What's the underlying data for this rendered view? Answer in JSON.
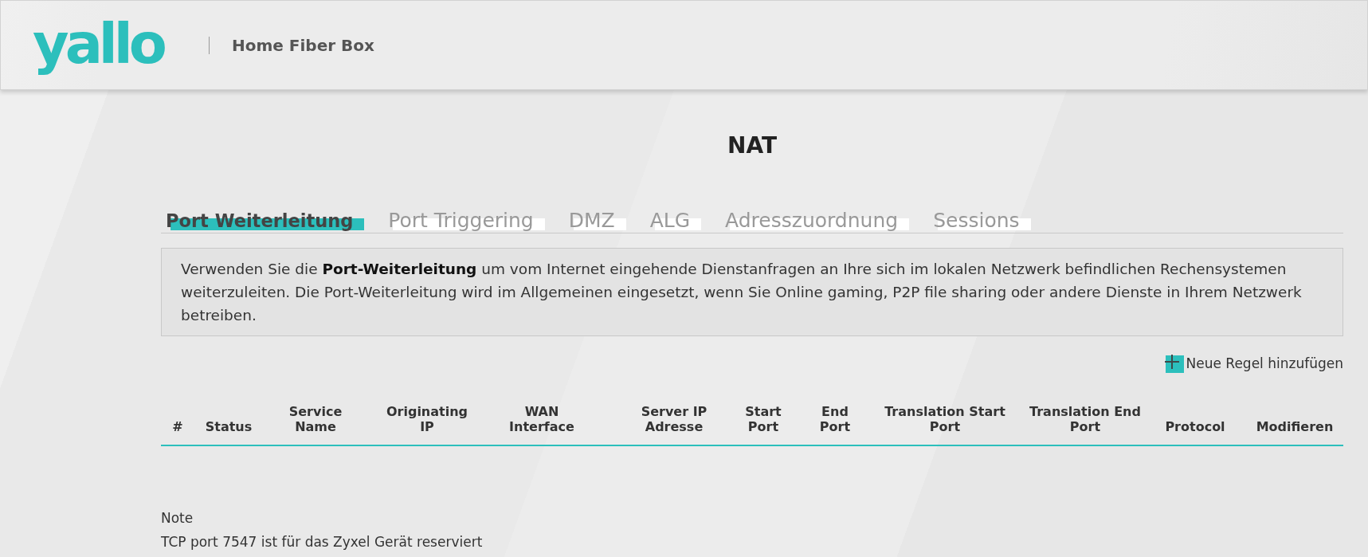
{
  "header": {
    "logo": "yallo",
    "title": "Home Fiber Box"
  },
  "page_title": "NAT",
  "tabs": [
    {
      "label": "Port Weiterleitung",
      "selected": true
    },
    {
      "label": "Port Triggering",
      "selected": false
    },
    {
      "label": "DMZ",
      "selected": false
    },
    {
      "label": "ALG",
      "selected": false
    },
    {
      "label": "Adresszuordnung",
      "selected": false
    },
    {
      "label": "Sessions",
      "selected": false
    }
  ],
  "description": "Verwenden Sie die **Port-Weiterleitung** um vom Internet eingehende Dienstanfragen an Ihre sich im lokalen Netzwerk befindlichen Rechensystemen weiterzuleiten. Die Port-Weiterleitung wird im Allgemeinen eingesetzt, wenn Sie Online gaming, P2P file sharing oder andere Dienste in Ihrem Netzwerk betreiben.",
  "add_rule": {
    "label": "Neue Regel hinzufügen"
  },
  "table": {
    "columns": [
      "#",
      "Status",
      "Service Name",
      "Originating IP",
      "WAN Interface",
      "Server IP Adresse",
      "Start Port",
      "End Port",
      "Translation Start Port",
      "Translation End Port",
      "Protocol",
      "Modifieren"
    ]
  },
  "note": {
    "title": "Note",
    "text": "TCP port 7547 ist für das Zyxel Gerät reserviert"
  }
}
